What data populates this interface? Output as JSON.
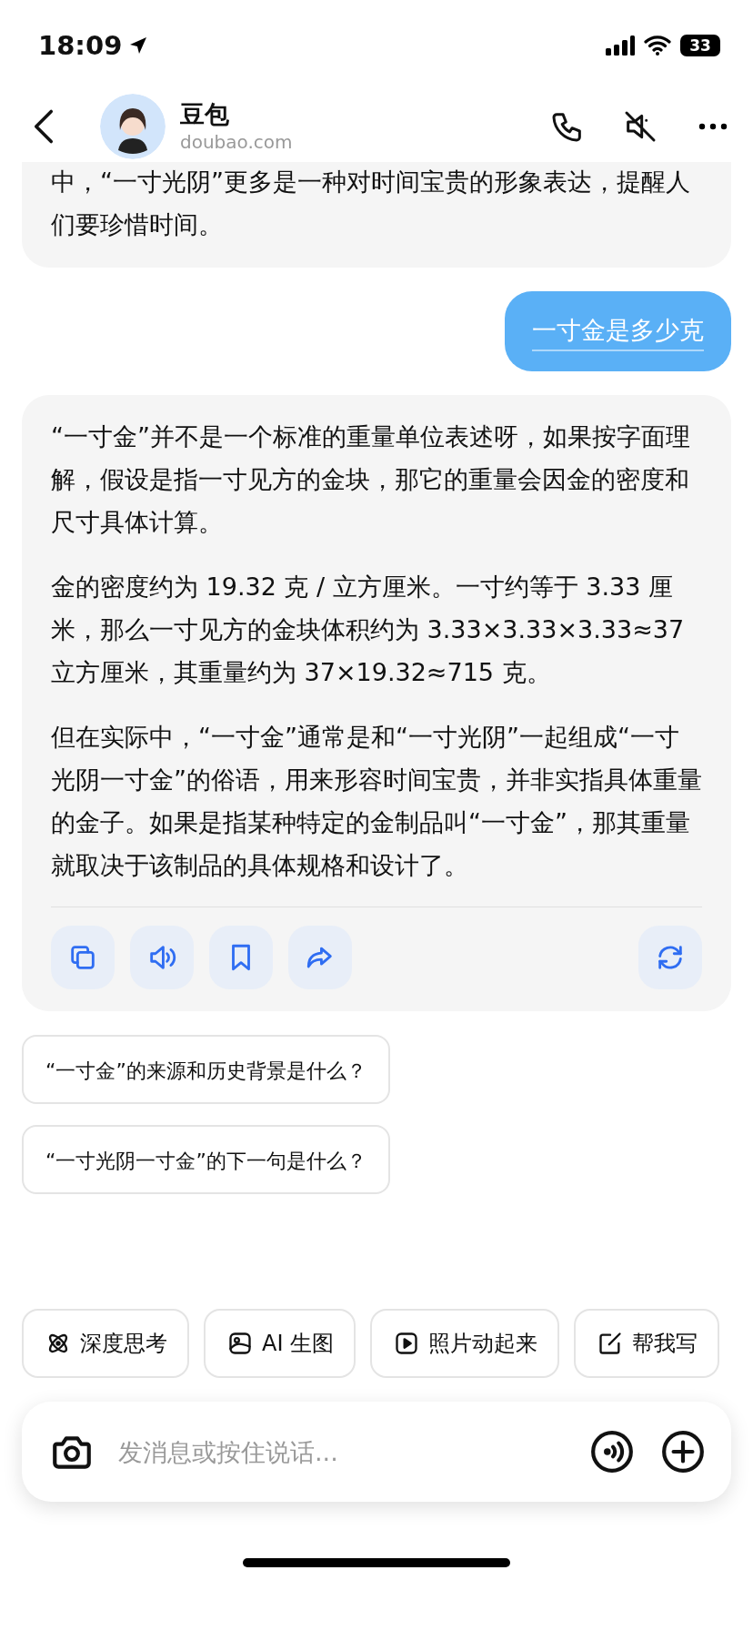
{
  "status_bar": {
    "time": "18:09",
    "battery": "33"
  },
  "header": {
    "title": "豆包",
    "subtitle": "doubao.com"
  },
  "messages": [
    {
      "kind": "bot_partial",
      "paragraphs": [
        "中，“一寸光阴”更多是一种对时间宝贵的形象表达，提醒人们要珍惜时间。"
      ]
    },
    {
      "kind": "user",
      "paragraphs": [
        "一寸金是多少克"
      ]
    },
    {
      "kind": "bot",
      "paragraphs": [
        "“一寸金”并不是一个标准的重量单位表述呀，如果按字面理解，假设是指一寸见方的金块，那它的重量会因金的密度和尺寸具体计算。",
        "金的密度约为 19.32 克 / 立方厘米。一寸约等于 3.33 厘米，那么一寸见方的金块体积约为 3.33×3.33×3.33≈37 立方厘米，其重量约为 37×19.32≈715 克。",
        "但在实际中，“一寸金”通常是和“一寸光阴”一起组成“一寸光阴一寸金”的俗语，用来形容时间宝贵，并非实指具体重量的金子。如果是指某种特定的金制品叫“一寸金”，那其重量就取决于该制品的具体规格和设计了。"
      ],
      "actions": [
        {
          "kind": "copy"
        },
        {
          "kind": "speaker"
        },
        {
          "kind": "bookmark"
        },
        {
          "kind": "share"
        },
        {
          "kind": "regenerate"
        }
      ]
    }
  ],
  "suggestions": [
    "“一寸金”的来源和历史背景是什么？",
    "“一寸光阴一寸金”的下一句是什么？"
  ],
  "tools": [
    {
      "label": "深度思考",
      "kind": "atom"
    },
    {
      "label": "AI 生图",
      "kind": "image"
    },
    {
      "label": "照片动起来",
      "kind": "play"
    },
    {
      "label": "帮我写",
      "kind": "edit"
    }
  ],
  "input": {
    "placeholder": "发消息或按住说话..."
  }
}
